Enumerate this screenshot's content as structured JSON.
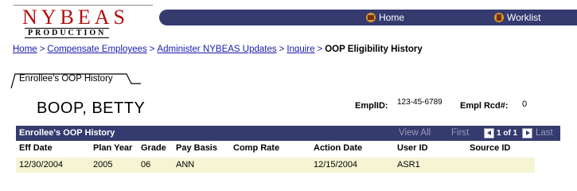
{
  "logo": {
    "name": "NYBEAS",
    "subtitle": "PRODUCTION"
  },
  "topnav": {
    "home": "Home",
    "worklist": "Worklist"
  },
  "breadcrumb": {
    "links": [
      "Home",
      "Compensate Employees",
      "Administer NYBEAS Updates",
      "Inquire"
    ],
    "separator": ">",
    "current": "OOP Eligibility History"
  },
  "tab": {
    "label": "Enrollee's OOP History"
  },
  "employee": {
    "name": "BOOP, BETTY",
    "emplid_label": "EmplID:",
    "emplid": "123-45-6789",
    "rcd_label": "Empl Rcd#:",
    "rcd": "0"
  },
  "grid": {
    "title": "Enrollee's OOP History",
    "view_all": "View All",
    "first": "First",
    "count": "1 of 1",
    "last": "Last",
    "columns": [
      "Eff Date",
      "Plan Year",
      "Grade",
      "Pay Basis",
      "Comp Rate",
      "Action Date",
      "User ID",
      "Source ID"
    ],
    "rows": [
      {
        "eff_date": "12/30/2004",
        "plan_year": "2005",
        "grade": "06",
        "pay_basis": "ANN",
        "comp_rate": "",
        "action_date": "12/15/2004",
        "user_id": "ASR1",
        "source_id": ""
      }
    ]
  },
  "colors": {
    "header_bg": "#353b6f",
    "row_bg": "#f5f5d3",
    "link": "#1a1ab0",
    "logo_red": "#b01010"
  }
}
